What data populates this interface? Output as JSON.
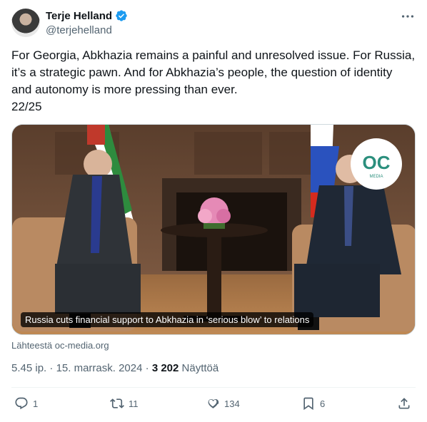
{
  "author": {
    "name": "Terje Helland",
    "handle": "@terjehelland"
  },
  "tweet": {
    "line1": "For Georgia, Abkhazia remains a painful and unresolved issue. For Russia, it’s a strategic pawn. And for Abkhazia’s people, the question of identity and autonomy is more pressing than ever.",
    "line2": "22/25"
  },
  "media": {
    "caption": "Russia cuts financial support to Abkhazia in ‘serious blow’ to relations",
    "logo_text": "OC",
    "logo_subtext": "MEDIA",
    "source": "Lähteestä oc-media.org"
  },
  "meta": {
    "time": "5.45 ip.",
    "date": "15. marrask. 2024",
    "views_count": "3 202",
    "views_label": "Näyttöä"
  },
  "actions": {
    "replies": "1",
    "reposts": "11",
    "likes": "134",
    "bookmarks": "6"
  },
  "colors": {
    "verified": "#1d9bf0",
    "text_secondary": "#536471"
  }
}
